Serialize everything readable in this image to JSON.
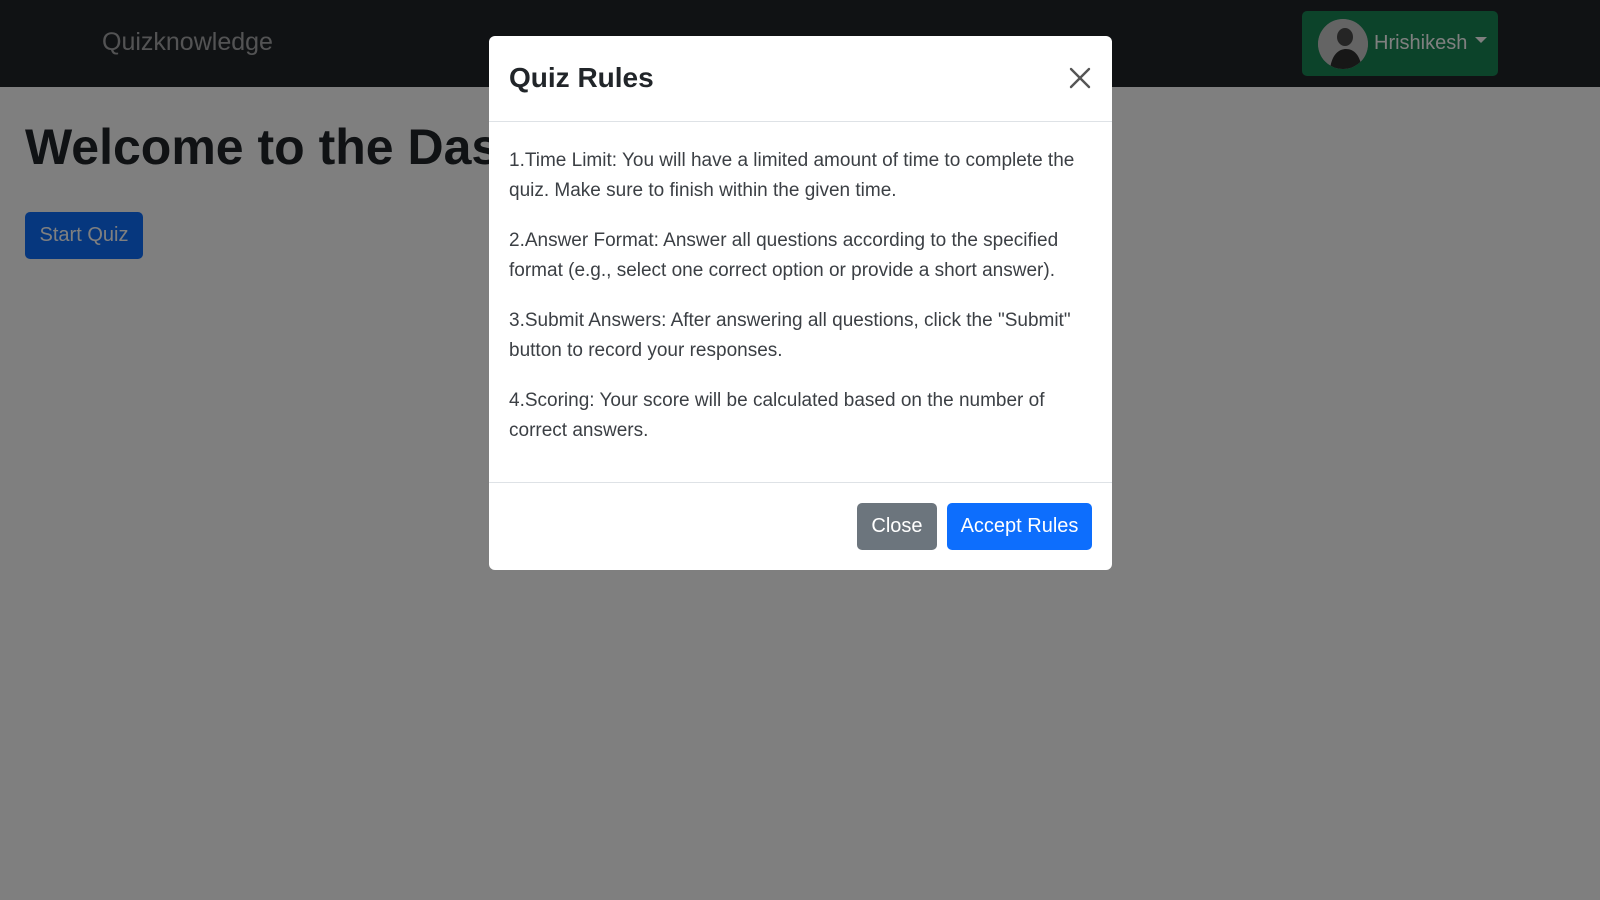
{
  "navbar": {
    "brand": "Quizknowledge",
    "user_name": "Hrishikesh"
  },
  "main": {
    "title": "Welcome to the Dashboard",
    "start_button": "Start Quiz"
  },
  "modal": {
    "title": "Quiz Rules",
    "rules": [
      "1.Time Limit: You will have a limited amount of time to complete the quiz. Make sure to finish within the given time.",
      "2.Answer Format: Answer all questions according to the specified format (e.g., select one correct option or provide a short answer).",
      "3.Submit Answers: After answering all questions, click the \"Submit\" button to record your responses.",
      "4.Scoring: Your score will be calculated based on the number of correct answers."
    ],
    "close_button": "Close",
    "accept_button": "Accept Rules"
  },
  "icons": {
    "close": "close-icon",
    "caret": "chevron-down-icon",
    "avatar": "avatar"
  },
  "colors": {
    "navbar_bg": "#212529",
    "user_button": "#198754",
    "primary": "#0d6efd",
    "secondary": "#6c757d"
  }
}
